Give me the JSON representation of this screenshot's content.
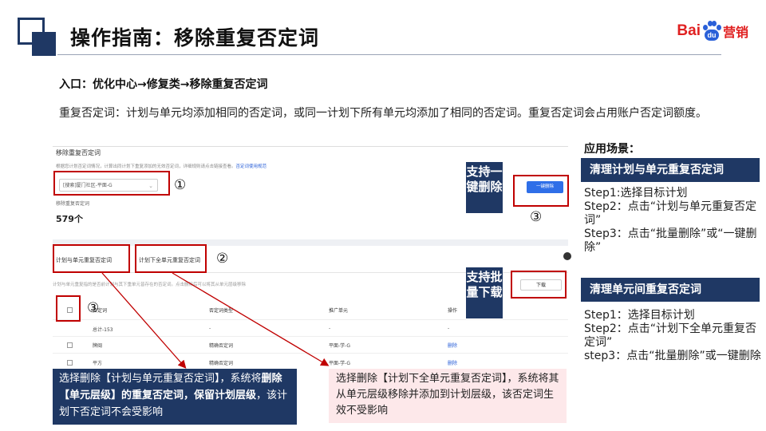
{
  "header": {
    "title": "操作指南：移除重复否定词",
    "logo_left": "Bai",
    "logo_mid": "du",
    "logo_right": "营销"
  },
  "entry": "入口：优化中心→修复类→移除重复否定词",
  "description": "重复否定词：计划与单元均添加相同的否定词，或同一计划下所有单元均添加了相同的否定词。重复否定词会占用账户否定词额度。",
  "screenshot": {
    "title": "移除重复否定词",
    "hint": "根据您计划否定词情况，计算出同计划下重复添加的无效否定词，详细规则请点击链接查看。",
    "hint_link": "否定词使用规范",
    "select_value": "[搜索]厦门社区-平面-G",
    "count_label": "移除重复否定词",
    "count_value": "579个",
    "tabs": [
      "计划与单元重复否定词",
      "计划下全单元重复否定词"
    ],
    "info_text": "计划与单元重复指的是否前计划与其下重单元皆存在的否定词。点击删除后可以将其从单元层级移除",
    "delete_all_button": "一键删除",
    "download_button": "下载",
    "table_headers": [
      "否定词",
      "否定词类型",
      "推广单元",
      "操作"
    ],
    "table_rows": [
      {
        "word": "总计-153",
        "type": "-",
        "unit": "-",
        "op": "-"
      },
      {
        "word": "牌闽",
        "type": "精确否定词",
        "unit": "平面-学-G",
        "op": "删除"
      },
      {
        "word": "平方",
        "type": "精确否定词",
        "unit": "平面-学-G",
        "op": "删除"
      }
    ]
  },
  "markers": {
    "m1": "①",
    "m2": "②",
    "m3a": "③",
    "m3b": "③"
  },
  "callouts": {
    "delete_all": "支持一键删除",
    "batch_download": "支持批量下载"
  },
  "notes": {
    "note1_a": "选择删除【计划与单元重复否定词】，系统将",
    "note1_b": "删除【单元层级】的重复否定词，保留计划层级",
    "note1_c": "，该计划下否定词不会受影响",
    "note2": "选择删除【计划下全单元重复否定词】，系统将其从单元层级移除并添加到计划层级，该否定词生效不受影响"
  },
  "sidebar": {
    "title": "应用场景：",
    "scene1": {
      "label": "清理计划与单元重复否定词",
      "steps": [
        "Step1:选择目标计划",
        "Step2：点击“计划与单元重复否定词”",
        "Step3：点击“批量删除”或“一键删除”"
      ]
    },
    "scene2": {
      "label": "清理单元间重复否定词",
      "steps": [
        "Step1：选择目标计划",
        "Step2：点击“计划下全单元重复否定词”",
        "step3：点击“批量删除”或一键删除"
      ]
    }
  },
  "colors": {
    "navy": "#1f3864",
    "red": "#c00000",
    "pink": "#fde8ea",
    "link_blue": "#2a60d8"
  }
}
